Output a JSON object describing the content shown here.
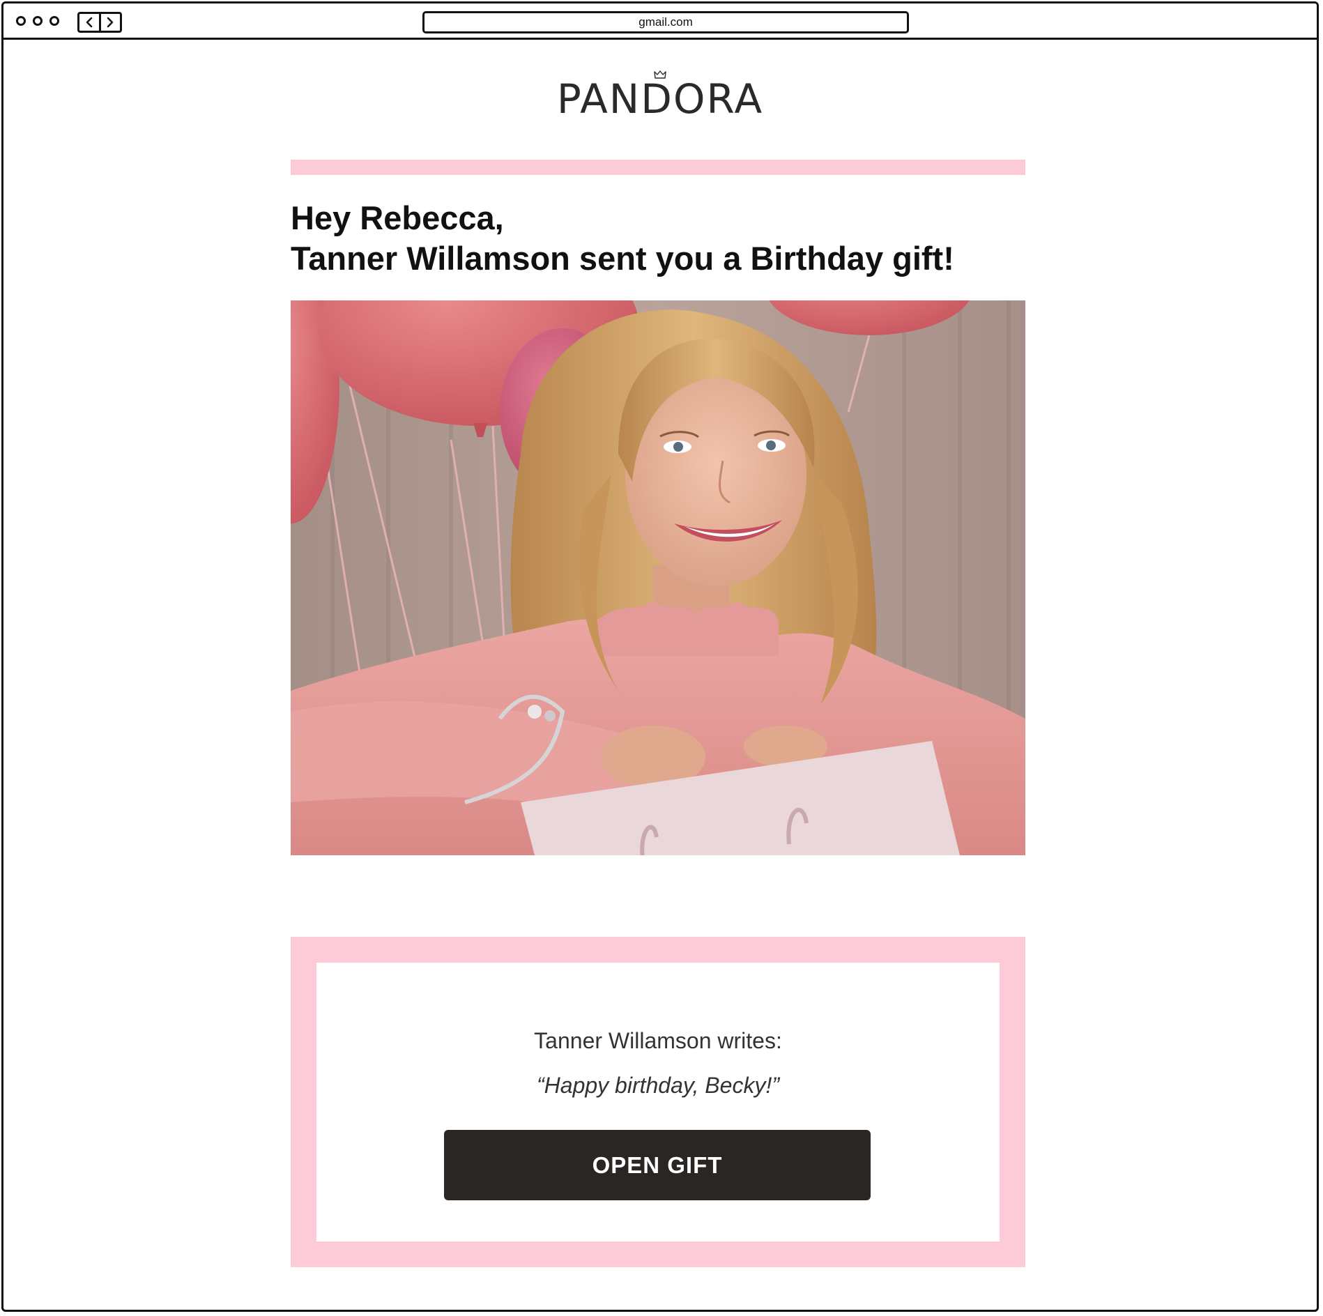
{
  "browser": {
    "url": "gmail.com"
  },
  "email": {
    "brand": "PANDORA",
    "greeting_line1": "Hey Rebecca,",
    "greeting_line2": "Tanner Willamson sent you a Birthday gift!",
    "message_author": "Tanner Willamson writes:",
    "message_text": "“Happy birthday, Becky!”",
    "cta_label": "OPEN GIFT"
  },
  "colors": {
    "accent_pink": "#fdcbd7",
    "button_dark": "#2a2624",
    "brand_text": "#2b2a28"
  },
  "icons": {
    "window_controls": "traffic-lights",
    "back": "chevron-left-icon",
    "forward": "chevron-right-icon",
    "logo_crown": "crown-icon"
  }
}
